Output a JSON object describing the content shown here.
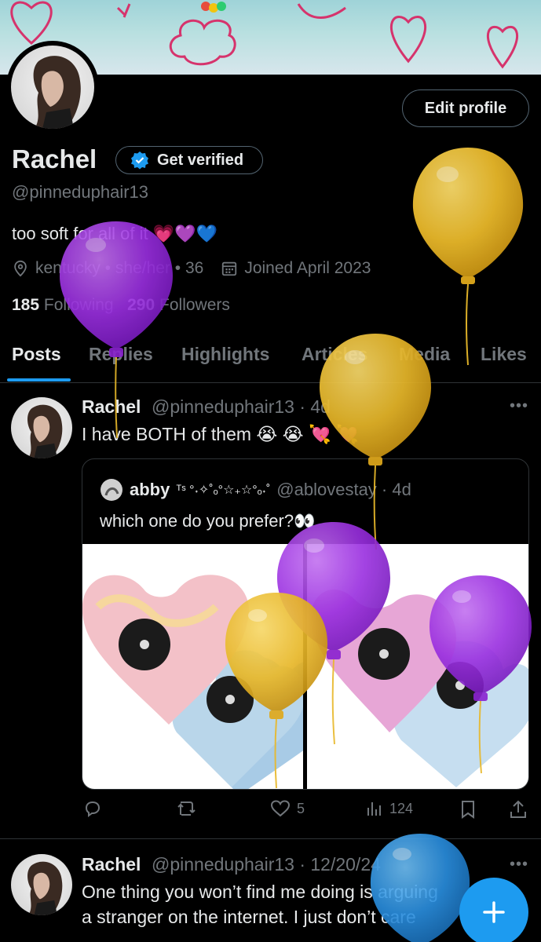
{
  "profile": {
    "name": "Rachel",
    "verify_label": "Get verified",
    "handle": "@pinneduphair13",
    "edit_label": "Edit profile",
    "bio": "too soft for all of it 💗💜💙",
    "location": "kentucky • she/her • 36",
    "joined": "Joined April 2023",
    "following_count": "185",
    "following_label": "Following",
    "followers_count": "290",
    "followers_label": "Followers"
  },
  "tabs": [
    "Posts",
    "Replies",
    "Highlights",
    "Articles",
    "Media",
    "Likes"
  ],
  "posts": [
    {
      "name": "Rachel",
      "handle": "@pinneduphair13 · 4d",
      "text": "I have BOTH of them 😭 😭 💘 💘",
      "more": "•••",
      "quote": {
        "name": "abby",
        "name_decor": "ᵀˢ °˖✧˚ₒ°☆₊☆°ₒ˖˚",
        "handle": "@ablovestay · 4d",
        "text": "which one do you prefer?👀"
      },
      "actions": {
        "reply": "",
        "repost": "",
        "likes": "5",
        "views": "124"
      }
    },
    {
      "name": "Rachel",
      "handle": "@pinneduphair13 · 12/20/24",
      "line1": "One thing you won’t find me doing is arguing",
      "line2": "a stranger on the internet. I just don’t care",
      "more": "•••"
    }
  ],
  "colors": {
    "accent": "#1d9bf0",
    "background": "#000000",
    "text": "#e7e9ea",
    "muted": "#71767b",
    "border": "#2f3336"
  },
  "icons": [
    "location-icon",
    "calendar-icon",
    "verified-badge-icon",
    "reply-icon",
    "repost-icon",
    "like-icon",
    "views-icon",
    "bookmark-icon",
    "share-icon",
    "plus-icon"
  ]
}
